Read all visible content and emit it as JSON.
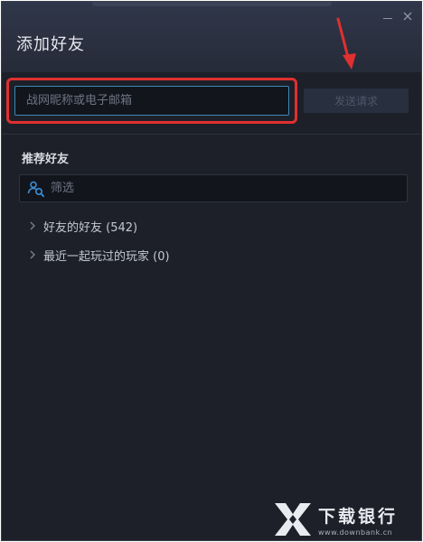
{
  "window": {
    "title": "添加好友"
  },
  "search": {
    "placeholder": "战网昵称或电子邮箱",
    "value": ""
  },
  "send_button": {
    "label": "发送请求"
  },
  "recommended": {
    "title": "推荐好友",
    "filter_placeholder": "筛选",
    "groups": [
      {
        "label": "好友的好友 (542)"
      },
      {
        "label": "最近一起玩过的玩家 (0)"
      }
    ]
  },
  "watermark": {
    "main": "下载银行",
    "sub": "www.downbank.cn"
  },
  "icons": {
    "minimize": "minimize-icon",
    "close": "close-icon",
    "filter": "user-search-icon",
    "chevron": "chevron-right-icon",
    "arrow": "arrow-down-annotation"
  },
  "colors": {
    "background": "#1d2029",
    "header": "#2b3141",
    "highlight": "#e0302f",
    "input_border": "#3c88b8",
    "filter_icon": "#3a8fd6"
  }
}
